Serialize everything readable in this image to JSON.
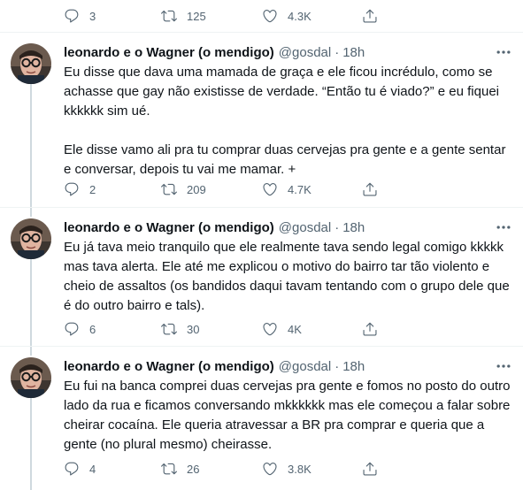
{
  "top_actions": {
    "replies": "3",
    "retweets": "125",
    "likes": "4.3K"
  },
  "tweets": [
    {
      "name": "leonardo e o Wagner (o mendigo)",
      "handle": "@gosdal",
      "time": "18h",
      "text": "Eu disse que dava uma mamada de graça e ele ficou incrédulo, como se achasse que gay não existisse de verdade. “Então tu é viado?” e eu fiquei kkkkkk sim ué.\n\nEle disse vamo ali pra tu comprar duas cervejas pra gente e a gente sentar e conversar, depois tu vai me mamar. +",
      "replies": "2",
      "retweets": "209",
      "likes": "4.7K"
    },
    {
      "name": "leonardo e o Wagner (o mendigo)",
      "handle": "@gosdal",
      "time": "18h",
      "text": "Eu já tava meio tranquilo que ele realmente tava sendo legal comigo kkkkk mas tava alerta. Ele até me explicou o motivo do bairro tar tão violento e cheio de assaltos (os bandidos daqui tavam tentando com o grupo dele que é do outro bairro e tals).",
      "replies": "6",
      "retweets": "30",
      "likes": "4K"
    },
    {
      "name": "leonardo e o Wagner (o mendigo)",
      "handle": "@gosdal",
      "time": "18h",
      "text": "Eu fui na banca comprei duas cervejas pra gente e fomos no posto do outro lado da rua e ficamos conversando mkkkkkk mas ele começou a falar sobre cheirar cocaína. Ele queria atravessar a BR pra comprar e queria que a gente (no plural mesmo) cheirasse.",
      "replies": "4",
      "retweets": "26",
      "likes": "3.8K"
    }
  ]
}
